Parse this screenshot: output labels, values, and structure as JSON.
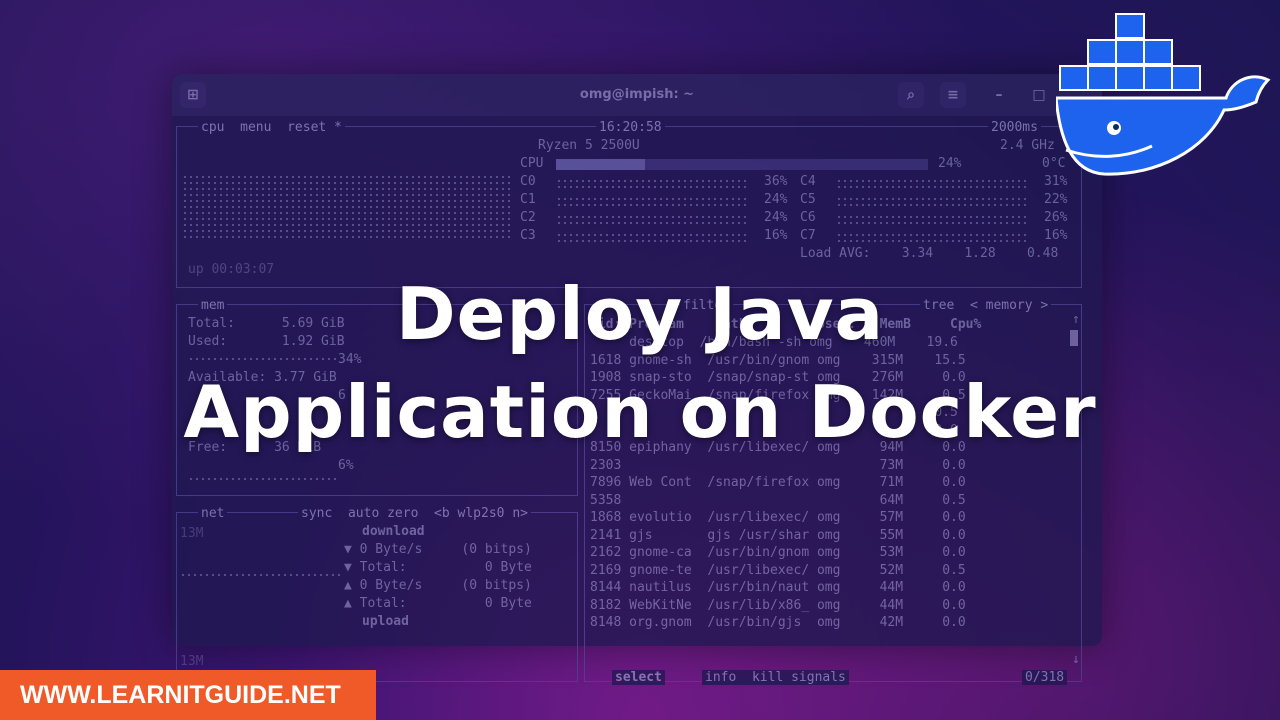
{
  "window": {
    "title": "omg@impish: ~",
    "buttons": [
      "⊞",
      "⌕",
      "≡",
      "–",
      "□"
    ]
  },
  "cpu": {
    "tabs": "cpu  menu  reset *",
    "clock": "16:20:58",
    "interval": "2000ms",
    "model": "Ryzen 5 2500U",
    "freq": "2.4 GHz",
    "total_label": "CPU",
    "total_pct": "24%",
    "temp": "0°C",
    "cores_left": [
      {
        "name": "C0",
        "pct": "36%"
      },
      {
        "name": "C1",
        "pct": "24%"
      },
      {
        "name": "C2",
        "pct": "24%"
      },
      {
        "name": "C3",
        "pct": "16%"
      }
    ],
    "cores_right": [
      {
        "name": "C4",
        "pct": "31%"
      },
      {
        "name": "C5",
        "pct": "22%"
      },
      {
        "name": "C6",
        "pct": "26%"
      },
      {
        "name": "C7",
        "pct": "16%"
      }
    ],
    "load": "Load AVG:    3.34    1.28    0.48",
    "uptime": "up 00:03:07"
  },
  "mem": {
    "label": "mem",
    "total": "Total:      5.69 GiB",
    "used": "Used:       1.92 GiB",
    "used_pct": "34%",
    "available": "Available: 3.77 GiB",
    "available_pct": "6",
    "free": "Free:      36 MiB",
    "free_pct": "6%"
  },
  "net": {
    "label": "net",
    "controls": "sync  auto zero  <b wlp2s0 n>",
    "scale_top": "13M",
    "scale_bottom": "13M",
    "download_label": "download",
    "upload_label": "upload",
    "rows": [
      "▼ 0 Byte/s     (0 bitps)",
      "▼ Total:          0 Byte",
      "▲ 0 Byte/s     (0 bitps)",
      "▲ Total:          0 Byte"
    ]
  },
  "proc": {
    "header_left": "filter",
    "header_right": "tree  < memory >",
    "columns": "Pid: Program    Path         User:   MemB     Cpu%",
    "rows": [
      "     desktop  /bin/bash -sh omg    460M    19.6",
      "1618 gnome-sh  /usr/bin/gnom omg    315M    15.5",
      "1908 snap-sto  /snap/snap-st omg    276M     0.0",
      "7255 GeckoMai  /snap/firefox omg    142M     0.5",
      "                                            0.5",
      "                                            0.0",
      "8150 epiphany  /usr/libexec/ omg     94M     0.0",
      "2303                                 73M     0.0",
      "7896 Web Cont  /snap/firefox omg     71M     0.0",
      "5358                                 64M     0.5",
      "1868 evolutio  /usr/libexec/ omg     57M     0.0",
      "2141 gjs       gjs /usr/shar omg     55M     0.0",
      "2162 gnome-ca  /usr/bin/gnom omg     53M     0.0",
      "2169 gnome-te  /usr/libexec/ omg     52M     0.5",
      "8144 nautilus  /usr/bin/naut omg     44M     0.0",
      "8182 WebKitNe  /usr/lib/x86_ omg     44M     0.0",
      "8148 org.gnom  /usr/bin/gjs  omg     42M     0.0"
    ],
    "footer_left": "select",
    "footer_mid": "info  kill signals",
    "footer_right": "0/318"
  },
  "headline": {
    "line1": "Deploy Java",
    "line2": "Application on Docker"
  },
  "badge": "WWW.LEARNITGUIDE.NET",
  "colors": {
    "badge": "#f05a28",
    "docker_blue": "#1d63ed",
    "background": "#24145c"
  },
  "logo": "docker-whale-logo"
}
